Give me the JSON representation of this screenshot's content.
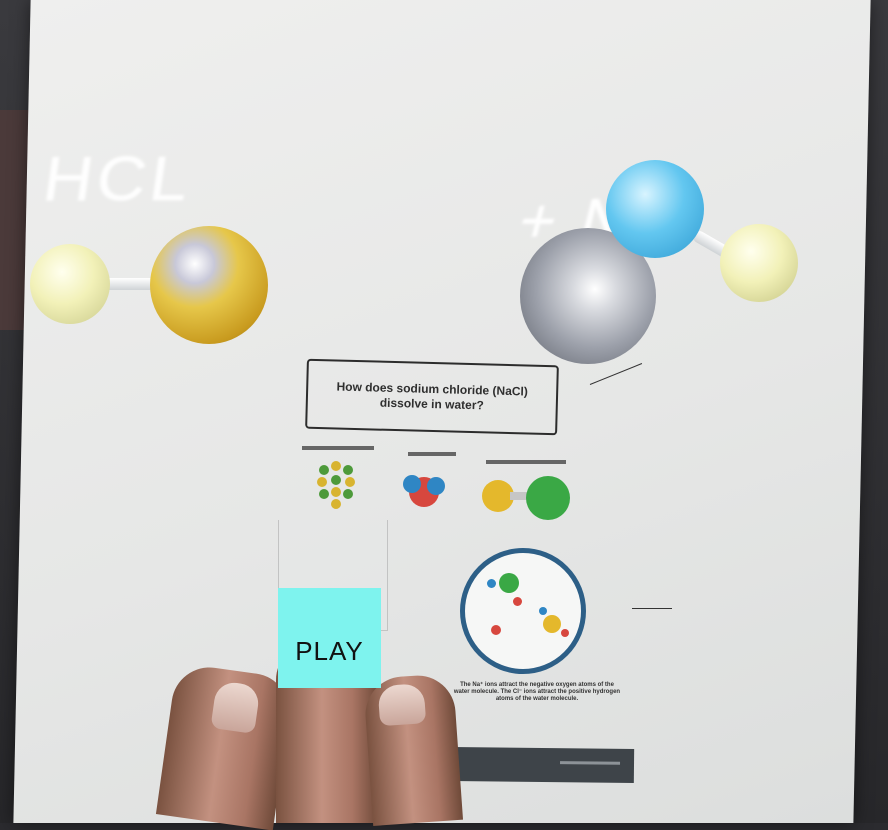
{
  "ar_labels": {
    "left_molecule_text": "HCL",
    "right_molecule_text": "+ Na"
  },
  "worksheet": {
    "question": "How does sodium chloride (NaCl) dissolve in water?",
    "caption": "The Na⁺ ions attract the negative oxygen atoms of the water molecule. The Cl⁻ ions attract the positive hydrogen atoms of the water molecule."
  },
  "play_button": {
    "label": "PLAY",
    "color": "#7ef3ee"
  },
  "colors": {
    "chlorine": "#d4b030",
    "hydrogen": "#f2f1b8",
    "nitrogen": "#4bb8e8",
    "sodium": "#9da1ab"
  }
}
